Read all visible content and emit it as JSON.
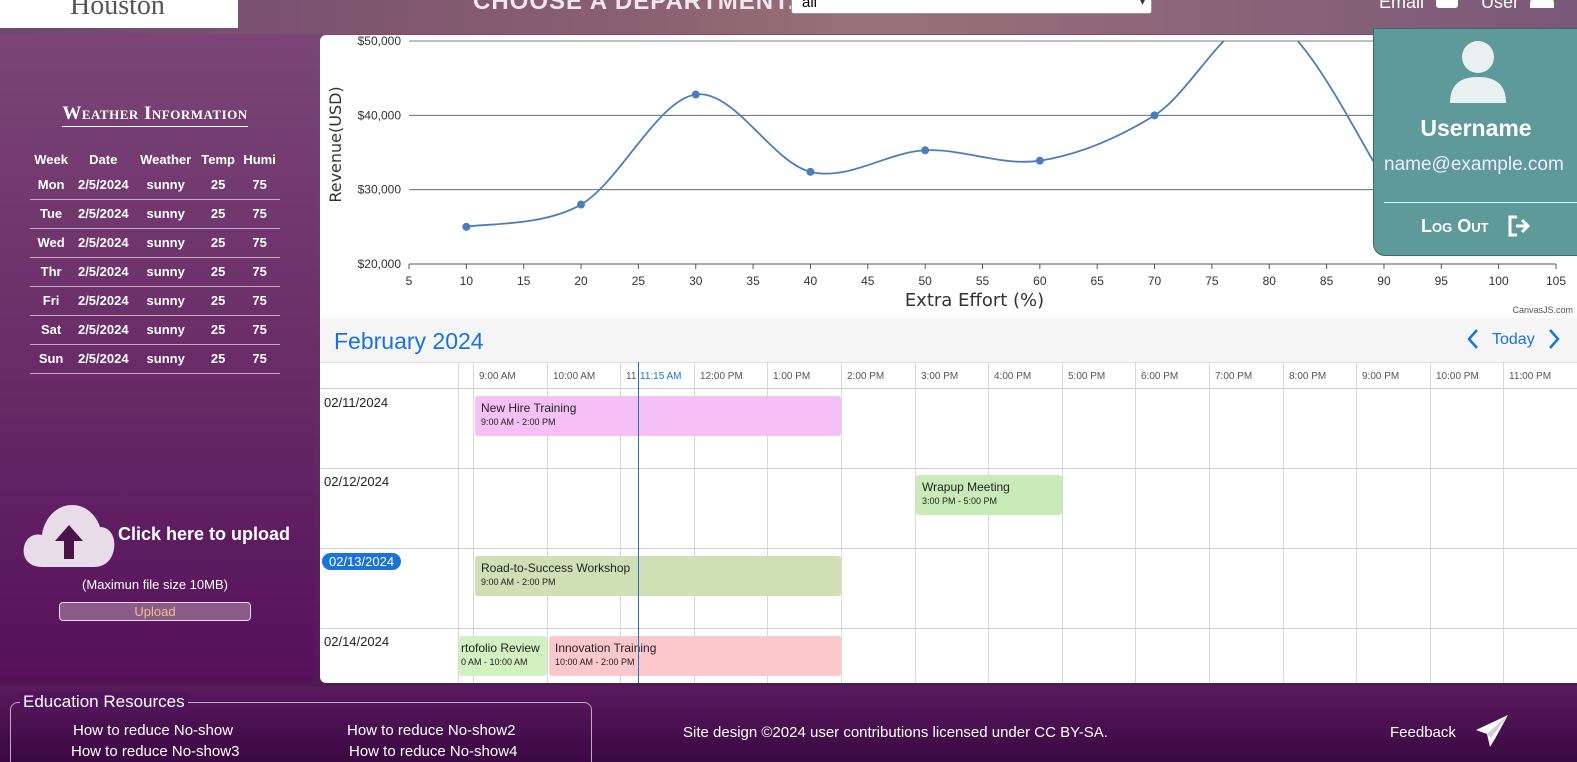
{
  "header": {
    "logo_text": "Houston",
    "department_label": "CHOOSE A DEPARTMENT:",
    "department_value": "all",
    "email_label": "Email",
    "user_label": "User"
  },
  "weather": {
    "title": "Weather Information",
    "columns": [
      "Week",
      "Date",
      "Weather",
      "Temp",
      "Humi"
    ],
    "rows": [
      [
        "Mon",
        "2/5/2024",
        "sunny",
        "25",
        "75"
      ],
      [
        "Tue",
        "2/5/2024",
        "sunny",
        "25",
        "75"
      ],
      [
        "Wed",
        "2/5/2024",
        "sunny",
        "25",
        "75"
      ],
      [
        "Thr",
        "2/5/2024",
        "sunny",
        "25",
        "75"
      ],
      [
        "Fri",
        "2/5/2024",
        "sunny",
        "25",
        "75"
      ],
      [
        "Sat",
        "2/5/2024",
        "sunny",
        "25",
        "75"
      ],
      [
        "Sun",
        "2/5/2024",
        "sunny",
        "25",
        "75"
      ]
    ]
  },
  "upload": {
    "label": "Click here to upload",
    "note": "(Maximun file size 10MB)",
    "button_label": "Upload"
  },
  "chart_data": {
    "type": "line",
    "title": "",
    "xlabel": "Extra Effort (%)",
    "ylabel": "Revenue(USD)",
    "x_ticks": [
      "5",
      "10",
      "15",
      "20",
      "25",
      "30",
      "35",
      "40",
      "45",
      "50",
      "55",
      "60",
      "65",
      "70",
      "75",
      "80",
      "85",
      "90",
      "95",
      "100",
      "105"
    ],
    "y_ticks": [
      "$20,000",
      "$30,000",
      "$40,000",
      "$50,000"
    ],
    "xlim": [
      5,
      105
    ],
    "ylim": [
      20000,
      50000
    ],
    "grid": true,
    "credit": "CanvasJS.com",
    "series": [
      {
        "points": [
          [
            10,
            25000
          ],
          [
            20,
            28000
          ],
          [
            30,
            42800
          ],
          [
            40,
            32400
          ],
          [
            50,
            35300
          ],
          [
            60,
            33900
          ],
          [
            70,
            40000
          ],
          [
            80,
            53000
          ],
          [
            90,
            31500
          ]
        ]
      }
    ],
    "line_color": "#4a7ebb"
  },
  "calendar": {
    "month_title": "February 2024",
    "today_label": "Today",
    "time_labels": [
      "9:00 AM",
      "10:00 AM",
      "11",
      "12:00 PM",
      "1:00 PM",
      "2:00 PM",
      "3:00 PM",
      "4:00 PM",
      "5:00 PM",
      "6:00 PM",
      "7:00 PM",
      "8:00 PM",
      "9:00 PM",
      "10:00 PM",
      "11:00 PM"
    ],
    "now_label": "11:15 AM",
    "dates": [
      "02/11/2024",
      "02/12/2024",
      "02/13/2024",
      "02/14/2024"
    ],
    "events": [
      {
        "title": "New Hire Training",
        "time": "9:00 AM - 2:00 PM",
        "color": "#f5c0f5"
      },
      {
        "title": "Wrapup Meeting",
        "time": "3:00 PM - 5:00 PM",
        "color": "#c8ebb8"
      },
      {
        "title": "Road-to-Success Workshop",
        "time": "9:00 AM - 2:00 PM",
        "color": "#cfe0b4"
      },
      {
        "title": "rtofolio Review",
        "time": "0 AM - 10:00 AM",
        "color": "#d2f0c0"
      },
      {
        "title": "Innovation Training",
        "time": "10:00 AM - 2:00 PM",
        "color": "#fcc8cc"
      }
    ]
  },
  "user_card": {
    "username": "Username",
    "email": "name@example.com",
    "logout_label": "Log Out"
  },
  "footer": {
    "edu_title": "Education Resources",
    "links": [
      "How to reduce No-show",
      "How to reduce No-show2",
      "How to reduce No-show3",
      "How to reduce No-show4"
    ],
    "copyright": "Site design ©2024 user contributions licensed under CC BY-SA.",
    "feedback": "Feedback"
  }
}
